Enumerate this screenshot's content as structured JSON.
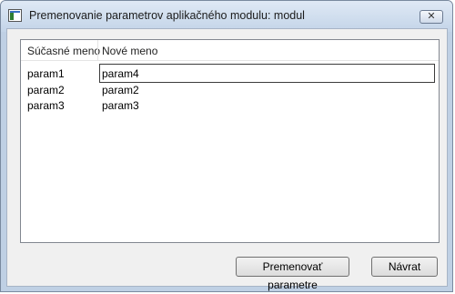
{
  "window": {
    "title": "Premenovanie parametrov aplikačného modulu: modul",
    "close_glyph": "✕"
  },
  "table": {
    "columns": [
      "Súčasné meno",
      "Nové meno"
    ],
    "rows": [
      {
        "current": "param1",
        "new": "param4"
      },
      {
        "current": "param2",
        "new": "param2"
      },
      {
        "current": "param3",
        "new": "param3"
      }
    ]
  },
  "buttons": {
    "rename_label": "Premenovať parametre",
    "back_label": "Návrat"
  }
}
